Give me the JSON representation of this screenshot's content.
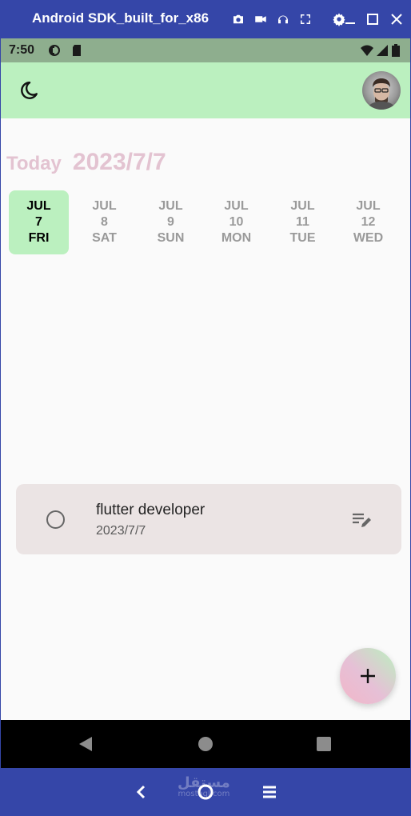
{
  "emulator": {
    "title": "Android SDK_built_for_x86",
    "toolbar_icons": [
      "camera-icon",
      "video-icon",
      "headphones-icon",
      "fullscreen-icon",
      "settings-icon"
    ],
    "window_controls": [
      "minimize-icon",
      "maximize-icon",
      "close-icon"
    ],
    "bottom_buttons": [
      "back-chevron-icon",
      "home-circle-icon",
      "menu-icon"
    ],
    "watermark": "مستقل",
    "watermark_sub": "mostaql.com"
  },
  "status_bar": {
    "time": "7:50",
    "left_icons": [
      "data-saver-icon",
      "sd-card-icon"
    ],
    "right_icons": [
      "wifi-icon",
      "signal-icon",
      "battery-icon"
    ]
  },
  "app_bar": {
    "theme_toggle_icon": "moon-icon",
    "avatar_icon": "profile-avatar"
  },
  "header": {
    "today_label": "Today",
    "today_date": "2023/7/7"
  },
  "day_strip": {
    "days": [
      {
        "month": "JUL",
        "day": "7",
        "weekday": "FRI",
        "selected": true
      },
      {
        "month": "JUL",
        "day": "8",
        "weekday": "SAT",
        "selected": false
      },
      {
        "month": "JUL",
        "day": "9",
        "weekday": "SUN",
        "selected": false
      },
      {
        "month": "JUL",
        "day": "10",
        "weekday": "MON",
        "selected": false
      },
      {
        "month": "JUL",
        "day": "11",
        "weekday": "TUE",
        "selected": false
      },
      {
        "month": "JUL",
        "day": "12",
        "weekday": "WED",
        "selected": false
      }
    ]
  },
  "tasks": [
    {
      "title": "flutter developer",
      "date": "2023/7/7",
      "completed": false
    }
  ],
  "fab": {
    "icon": "plus-icon"
  },
  "nav_bar": {
    "buttons": [
      "back-triangle-icon",
      "home-dot-icon",
      "recents-square-icon"
    ]
  },
  "colors": {
    "accent_green": "#bbf0bf",
    "accent_pink": "#e3c3d1",
    "emulator_blue": "#3546a8",
    "card_bg": "#ebe4e4"
  }
}
